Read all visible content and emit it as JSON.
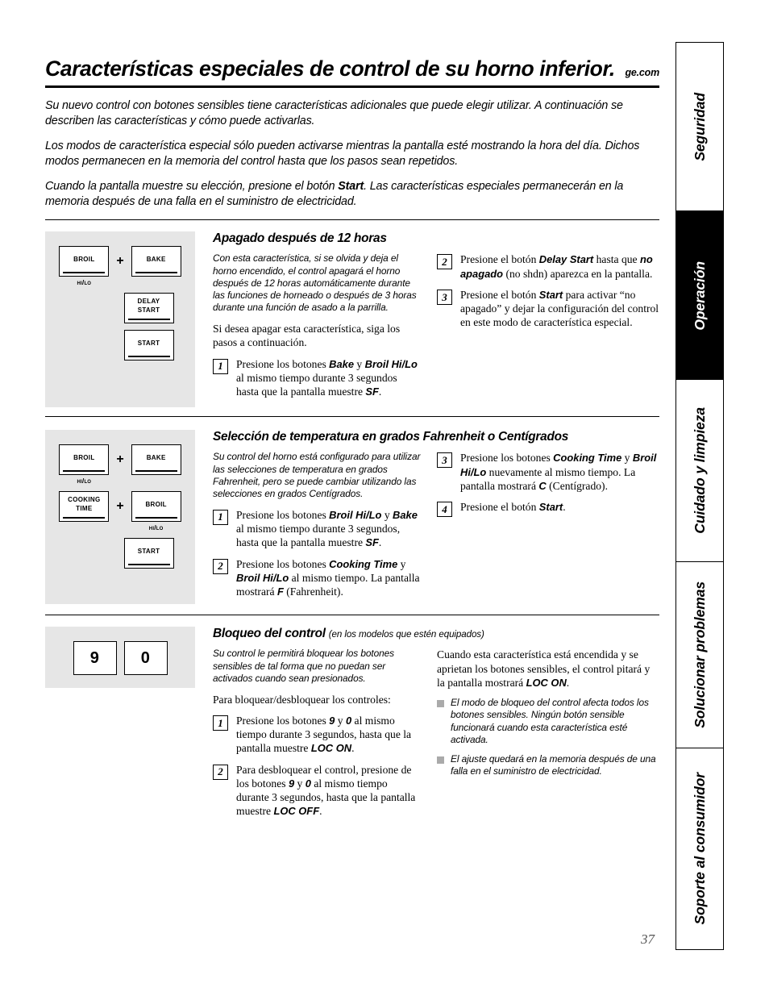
{
  "header": {
    "title": "Características especiales de control de su horno inferior.",
    "website": "ge.com"
  },
  "intro": {
    "p1_a": "Su nuevo control con botones sensibles tiene características adicionales que puede elegir utilizar. A continuación se describen las características y cómo puede activarlas.",
    "p2_a": "Los modos de característica especial sólo pueden activarse mientras la pantalla esté mostrando la hora del día. Dichos modos permanecen en la memoria del control hasta que los pasos sean repetidos.",
    "p3_a": "Cuando la pantalla muestre su elección, presione el botón ",
    "p3_b": "Start",
    "p3_c": ". Las características especiales permanecerán en la memoria después de una falla en el suministro de electricidad."
  },
  "sidebar": {
    "tabs": [
      {
        "label": "Seguridad",
        "active": false
      },
      {
        "label": "Operación",
        "active": true
      },
      {
        "label": "Cuidado y limpieza",
        "active": false
      },
      {
        "label": "Solucionar problemas",
        "active": false
      },
      {
        "label": "Soporte al consumidor",
        "active": false
      }
    ]
  },
  "section1": {
    "heading": "Apagado después de 12 horas",
    "intro_italic": "Con esta característica, si se olvida y deja el horno encendido, el control apagará el horno después de 12 horas automáticamente durante las funciones de horneado o después de 3 horas durante una función de asado a la parrilla.",
    "intro_serif": "Si desea apagar esta característica, siga los pasos a continuación.",
    "buttons": {
      "broil": "Broil",
      "broil_sub": "Hi/Lo",
      "plus": "+",
      "bake": "Bake",
      "delay_start_l1": "Delay",
      "delay_start_l2": "Start",
      "start": "Start"
    },
    "steps": [
      {
        "num": "1",
        "a": "Presione los botones ",
        "b1": "Bake",
        "c": " y ",
        "b2": "Broil Hi/Lo",
        "d": " al mismo tiempo durante 3 segundos hasta que la pantalla muestre ",
        "b3": "SF",
        "e": "."
      },
      {
        "num": "2",
        "a": "Presione el botón ",
        "b1": "Delay Start",
        "c": " hasta que ",
        "b2": "no apagado",
        "d": " (no shdn) aparezca en la pantalla.",
        "b3": "",
        "e": ""
      },
      {
        "num": "3",
        "a": "Presione el botón ",
        "b1": "Start",
        "c": " para activar “no apagado” y dejar la configuración del control en este modo de característica especial.",
        "b2": "",
        "d": "",
        "b3": "",
        "e": ""
      }
    ]
  },
  "section2": {
    "heading": "Selección de temperatura en grados Fahrenheit o Centígrados",
    "intro_italic": "Su control del horno está configurado para utilizar las selecciones de temperatura en grados Fahrenheit, pero se puede cambiar utilizando las selecciones en grados Centígrados.",
    "buttons": {
      "broil": "Broil",
      "broil_sub": "Hi/Lo",
      "plus": "+",
      "bake": "Bake",
      "cooking_time_l1": "Cooking",
      "cooking_time_l2": "Time",
      "broil2": "Broil",
      "broil2_sub": "Hi/Lo",
      "start": "Start"
    },
    "steps": [
      {
        "num": "1",
        "a": "Presione los botones ",
        "b1": "Broil Hi/Lo",
        "c": " y ",
        "b2": "Bake",
        "d": " al mismo tiempo durante 3 segundos, hasta que la pantalla muestre ",
        "b3": "SF",
        "e": "."
      },
      {
        "num": "2",
        "a": "Presione los botones ",
        "b1": "Cooking Time",
        "c": " y ",
        "b2": "Broil Hi/Lo",
        "d": " al mismo tiempo. La pantalla mostrará ",
        "b3": "F",
        "e": " (Fahrenheit)."
      },
      {
        "num": "3",
        "a": "Presione los botones ",
        "b1": "Cooking Time",
        "c": " y ",
        "b2": "Broil Hi/Lo",
        "d": " nuevamente al mismo tiempo. La pantalla mostrará ",
        "b3": "C",
        "e": " (Centígrado)."
      },
      {
        "num": "4",
        "a": "Presione el botón ",
        "b1": "Start",
        "c": ".",
        "b2": "",
        "d": "",
        "b3": "",
        "e": ""
      }
    ]
  },
  "section3": {
    "heading": "Bloqueo del control",
    "heading_note": "(en los modelos que estén equipados)",
    "intro_italic": "Su control le permitirá bloquear los botones sensibles de tal forma que no puedan ser activados cuando sean presionados.",
    "intro_serif": "Para bloquear/desbloquear los controles:",
    "buttons": {
      "nine": "9",
      "zero": "0"
    },
    "steps": [
      {
        "num": "1",
        "a": "Presione los botones ",
        "b1": "9",
        "c": " y ",
        "b2": "0",
        "d": " al mismo tiempo durante 3 segundos, hasta que la pantalla muestre ",
        "b3": "LOC ON",
        "e": "."
      },
      {
        "num": "2",
        "a": "Para desbloquear el control, presione de los botones ",
        "b1": "9",
        "c": " y ",
        "b2": "0",
        "d": " al mismo tiempo durante 3 segundos, hasta que la pantalla muestre ",
        "b3": "LOC OFF",
        "e": "."
      }
    ],
    "right_paragraph": {
      "a": "Cuando esta característica está encendida y se aprietan los botones sensibles, el control pitará y la pantalla mostrará ",
      "b": "LOC ON",
      "c": "."
    },
    "bullets": [
      "El modo de bloqueo del control afecta todos los botones sensibles. Ningún botón sensible funcionará cuando esta característica esté activada.",
      "El ajuste quedará en la memoria después de una falla en el suministro de electricidad."
    ]
  },
  "footer": {
    "page_number": "37"
  }
}
